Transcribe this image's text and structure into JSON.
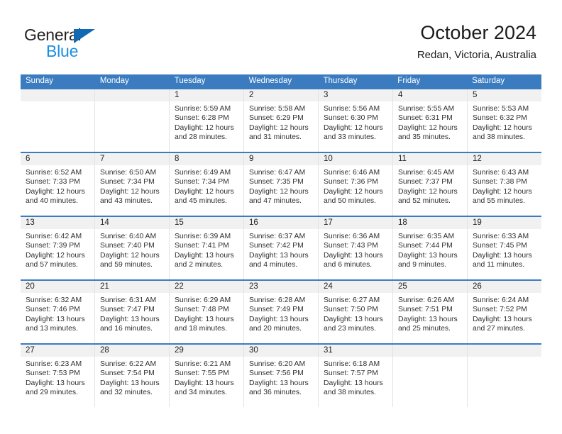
{
  "brand": {
    "name_part1": "General",
    "name_part2": "Blue",
    "color_dark": "#231f20",
    "color_blue": "#1a8fe0",
    "triangle_color": "#1268b3"
  },
  "header": {
    "title": "October 2024",
    "subtitle": "Redan, Victoria, Australia"
  },
  "theme": {
    "header_bg": "#3b7cc0",
    "daynum_bg": "#f1f1f1",
    "grid_line": "#e3e3e3"
  },
  "weekdays": [
    "Sunday",
    "Monday",
    "Tuesday",
    "Wednesday",
    "Thursday",
    "Friday",
    "Saturday"
  ],
  "weeks": [
    [
      {
        "day": "",
        "sunrise": "",
        "sunset": "",
        "daylight1": "",
        "daylight2": ""
      },
      {
        "day": "",
        "sunrise": "",
        "sunset": "",
        "daylight1": "",
        "daylight2": ""
      },
      {
        "day": "1",
        "sunrise": "Sunrise: 5:59 AM",
        "sunset": "Sunset: 6:28 PM",
        "daylight1": "Daylight: 12 hours",
        "daylight2": "and 28 minutes."
      },
      {
        "day": "2",
        "sunrise": "Sunrise: 5:58 AM",
        "sunset": "Sunset: 6:29 PM",
        "daylight1": "Daylight: 12 hours",
        "daylight2": "and 31 minutes."
      },
      {
        "day": "3",
        "sunrise": "Sunrise: 5:56 AM",
        "sunset": "Sunset: 6:30 PM",
        "daylight1": "Daylight: 12 hours",
        "daylight2": "and 33 minutes."
      },
      {
        "day": "4",
        "sunrise": "Sunrise: 5:55 AM",
        "sunset": "Sunset: 6:31 PM",
        "daylight1": "Daylight: 12 hours",
        "daylight2": "and 35 minutes."
      },
      {
        "day": "5",
        "sunrise": "Sunrise: 5:53 AM",
        "sunset": "Sunset: 6:32 PM",
        "daylight1": "Daylight: 12 hours",
        "daylight2": "and 38 minutes."
      }
    ],
    [
      {
        "day": "6",
        "sunrise": "Sunrise: 6:52 AM",
        "sunset": "Sunset: 7:33 PM",
        "daylight1": "Daylight: 12 hours",
        "daylight2": "and 40 minutes."
      },
      {
        "day": "7",
        "sunrise": "Sunrise: 6:50 AM",
        "sunset": "Sunset: 7:34 PM",
        "daylight1": "Daylight: 12 hours",
        "daylight2": "and 43 minutes."
      },
      {
        "day": "8",
        "sunrise": "Sunrise: 6:49 AM",
        "sunset": "Sunset: 7:34 PM",
        "daylight1": "Daylight: 12 hours",
        "daylight2": "and 45 minutes."
      },
      {
        "day": "9",
        "sunrise": "Sunrise: 6:47 AM",
        "sunset": "Sunset: 7:35 PM",
        "daylight1": "Daylight: 12 hours",
        "daylight2": "and 47 minutes."
      },
      {
        "day": "10",
        "sunrise": "Sunrise: 6:46 AM",
        "sunset": "Sunset: 7:36 PM",
        "daylight1": "Daylight: 12 hours",
        "daylight2": "and 50 minutes."
      },
      {
        "day": "11",
        "sunrise": "Sunrise: 6:45 AM",
        "sunset": "Sunset: 7:37 PM",
        "daylight1": "Daylight: 12 hours",
        "daylight2": "and 52 minutes."
      },
      {
        "day": "12",
        "sunrise": "Sunrise: 6:43 AM",
        "sunset": "Sunset: 7:38 PM",
        "daylight1": "Daylight: 12 hours",
        "daylight2": "and 55 minutes."
      }
    ],
    [
      {
        "day": "13",
        "sunrise": "Sunrise: 6:42 AM",
        "sunset": "Sunset: 7:39 PM",
        "daylight1": "Daylight: 12 hours",
        "daylight2": "and 57 minutes."
      },
      {
        "day": "14",
        "sunrise": "Sunrise: 6:40 AM",
        "sunset": "Sunset: 7:40 PM",
        "daylight1": "Daylight: 12 hours",
        "daylight2": "and 59 minutes."
      },
      {
        "day": "15",
        "sunrise": "Sunrise: 6:39 AM",
        "sunset": "Sunset: 7:41 PM",
        "daylight1": "Daylight: 13 hours",
        "daylight2": "and 2 minutes."
      },
      {
        "day": "16",
        "sunrise": "Sunrise: 6:37 AM",
        "sunset": "Sunset: 7:42 PM",
        "daylight1": "Daylight: 13 hours",
        "daylight2": "and 4 minutes."
      },
      {
        "day": "17",
        "sunrise": "Sunrise: 6:36 AM",
        "sunset": "Sunset: 7:43 PM",
        "daylight1": "Daylight: 13 hours",
        "daylight2": "and 6 minutes."
      },
      {
        "day": "18",
        "sunrise": "Sunrise: 6:35 AM",
        "sunset": "Sunset: 7:44 PM",
        "daylight1": "Daylight: 13 hours",
        "daylight2": "and 9 minutes."
      },
      {
        "day": "19",
        "sunrise": "Sunrise: 6:33 AM",
        "sunset": "Sunset: 7:45 PM",
        "daylight1": "Daylight: 13 hours",
        "daylight2": "and 11 minutes."
      }
    ],
    [
      {
        "day": "20",
        "sunrise": "Sunrise: 6:32 AM",
        "sunset": "Sunset: 7:46 PM",
        "daylight1": "Daylight: 13 hours",
        "daylight2": "and 13 minutes."
      },
      {
        "day": "21",
        "sunrise": "Sunrise: 6:31 AM",
        "sunset": "Sunset: 7:47 PM",
        "daylight1": "Daylight: 13 hours",
        "daylight2": "and 16 minutes."
      },
      {
        "day": "22",
        "sunrise": "Sunrise: 6:29 AM",
        "sunset": "Sunset: 7:48 PM",
        "daylight1": "Daylight: 13 hours",
        "daylight2": "and 18 minutes."
      },
      {
        "day": "23",
        "sunrise": "Sunrise: 6:28 AM",
        "sunset": "Sunset: 7:49 PM",
        "daylight1": "Daylight: 13 hours",
        "daylight2": "and 20 minutes."
      },
      {
        "day": "24",
        "sunrise": "Sunrise: 6:27 AM",
        "sunset": "Sunset: 7:50 PM",
        "daylight1": "Daylight: 13 hours",
        "daylight2": "and 23 minutes."
      },
      {
        "day": "25",
        "sunrise": "Sunrise: 6:26 AM",
        "sunset": "Sunset: 7:51 PM",
        "daylight1": "Daylight: 13 hours",
        "daylight2": "and 25 minutes."
      },
      {
        "day": "26",
        "sunrise": "Sunrise: 6:24 AM",
        "sunset": "Sunset: 7:52 PM",
        "daylight1": "Daylight: 13 hours",
        "daylight2": "and 27 minutes."
      }
    ],
    [
      {
        "day": "27",
        "sunrise": "Sunrise: 6:23 AM",
        "sunset": "Sunset: 7:53 PM",
        "daylight1": "Daylight: 13 hours",
        "daylight2": "and 29 minutes."
      },
      {
        "day": "28",
        "sunrise": "Sunrise: 6:22 AM",
        "sunset": "Sunset: 7:54 PM",
        "daylight1": "Daylight: 13 hours",
        "daylight2": "and 32 minutes."
      },
      {
        "day": "29",
        "sunrise": "Sunrise: 6:21 AM",
        "sunset": "Sunset: 7:55 PM",
        "daylight1": "Daylight: 13 hours",
        "daylight2": "and 34 minutes."
      },
      {
        "day": "30",
        "sunrise": "Sunrise: 6:20 AM",
        "sunset": "Sunset: 7:56 PM",
        "daylight1": "Daylight: 13 hours",
        "daylight2": "and 36 minutes."
      },
      {
        "day": "31",
        "sunrise": "Sunrise: 6:18 AM",
        "sunset": "Sunset: 7:57 PM",
        "daylight1": "Daylight: 13 hours",
        "daylight2": "and 38 minutes."
      },
      {
        "day": "",
        "sunrise": "",
        "sunset": "",
        "daylight1": "",
        "daylight2": ""
      },
      {
        "day": "",
        "sunrise": "",
        "sunset": "",
        "daylight1": "",
        "daylight2": ""
      }
    ]
  ]
}
